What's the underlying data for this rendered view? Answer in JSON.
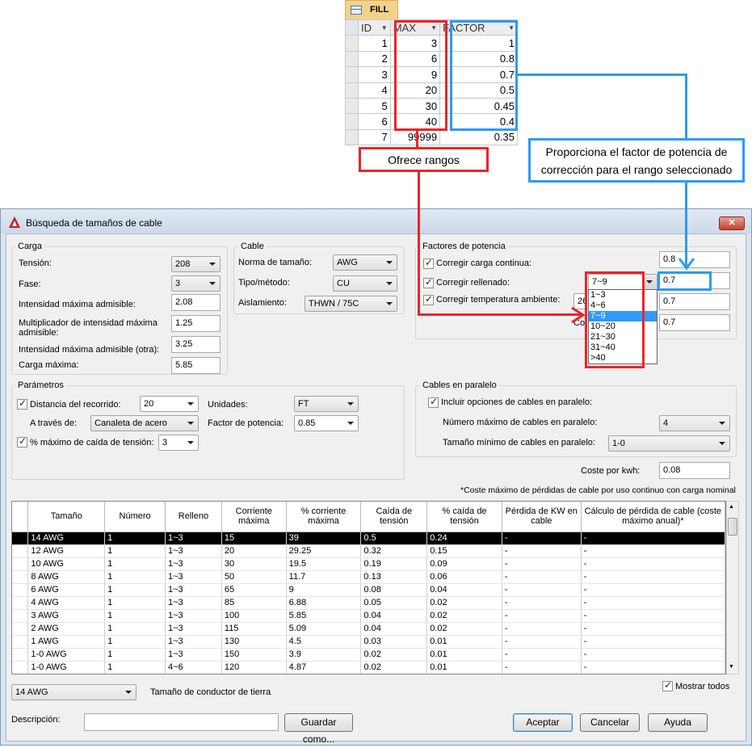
{
  "fill_table": {
    "tab_label": "FILL",
    "columns": [
      "ID",
      "MAX",
      "FACTOR"
    ],
    "rows": [
      [
        "1",
        "3",
        "1"
      ],
      [
        "2",
        "6",
        "0.8"
      ],
      [
        "3",
        "9",
        "0.7"
      ],
      [
        "4",
        "20",
        "0.5"
      ],
      [
        "5",
        "30",
        "0.45"
      ],
      [
        "6",
        "40",
        "0.4"
      ],
      [
        "7",
        "99999",
        "0.35"
      ]
    ]
  },
  "callouts": {
    "ranges": "Ofrece rangos",
    "factor": "Proporciona el factor de potencia de corrección para el rango seleccionado"
  },
  "dialog": {
    "title": "Búsqueda de tamaños de cable",
    "carga": {
      "group_label": "Carga",
      "tension_label": "Tensión:",
      "tension_value": "208",
      "fase_label": "Fase:",
      "fase_value": "3",
      "intensidad_label": "Intensidad máxima admisible:",
      "intensidad_value": "2.08",
      "multiplicador_label": "Multiplicador de intensidad máxima admisible:",
      "multiplicador_value": "1.25",
      "intensidad_otra_label": "Intensidad máxima admisible (otra):",
      "intensidad_otra_value": "3.25",
      "carga_max_label": "Carga máxima:",
      "carga_max_value": "5.85"
    },
    "cable": {
      "group_label": "Cable",
      "norma_label": "Norma de tamaño:",
      "norma_value": "AWG",
      "tipo_label": "Tipo/método:",
      "tipo_value": "CU",
      "aislamiento_label": "Aislamiento:",
      "aislamiento_value": "THWN / 75C"
    },
    "factores": {
      "group_label": "Factores de potencia",
      "continua_label": "Corregir carga continua:",
      "continua_value": "0.8",
      "rellenado_label": "Corregir rellenado:",
      "rellenado_combo": "7~9",
      "rellenado_value": "0.7",
      "temperatura_label": "Corregir temperatura ambiente:",
      "temperatura_combo": "26",
      "fourth_label_partial": "Co",
      "fourth_value": "0.7",
      "dropdown_options": [
        "1~3",
        "4~6",
        "7~9",
        "10~20",
        "21~30",
        "31~40",
        ">40"
      ],
      "dropdown_selected": "7~9"
    },
    "parametros": {
      "group_label": "Parámetros",
      "distancia_label": "Distancia del recorrido:",
      "distancia_value": "20",
      "unidades_label": "Unidades:",
      "unidades_value": "FT",
      "atraves_label": "A través de:",
      "atraves_value": "Canaleta de acero",
      "factor_label": "Factor de potencia:",
      "factor_value": "0.85",
      "caida_label": "% máximo de caída de tensión:",
      "caida_value": "3"
    },
    "paralelo": {
      "group_label": "Cables en paralelo",
      "incluir_label": "Incluir opciones de cables en paralelo:",
      "numero_label": "Número máximo de cables en paralelo:",
      "numero_value": "4",
      "tamano_label": "Tamaño mínimo de cables en paralelo:",
      "tamano_value": "1-0"
    },
    "coste_label": "Coste por kwh:",
    "coste_value": "0.08",
    "note": "*Coste máximo de pérdidas de cable por uso continuo con carga nominal",
    "grid": {
      "headers": [
        "Tamaño",
        "Número",
        "Relleno",
        "Corriente máxima",
        "% corriente máxima",
        "Caída de tensión",
        "% caída de tensión",
        "Pérdida de KW en cable",
        "Cálculo de pérdida de cable (coste máximo anual)*"
      ],
      "rows": [
        [
          "14 AWG",
          "1",
          "1~3",
          "15",
          "39",
          "0.5",
          "0.24",
          "-",
          "-"
        ],
        [
          "12 AWG",
          "1",
          "1~3",
          "20",
          "29.25",
          "0.32",
          "0.15",
          "-",
          "-"
        ],
        [
          "10 AWG",
          "1",
          "1~3",
          "30",
          "19.5",
          "0.19",
          "0.09",
          "-",
          "-"
        ],
        [
          "8 AWG",
          "1",
          "1~3",
          "50",
          "11.7",
          "0.13",
          "0.06",
          "-",
          "-"
        ],
        [
          "6 AWG",
          "1",
          "1~3",
          "65",
          "9",
          "0.08",
          "0.04",
          "-",
          "-"
        ],
        [
          "4 AWG",
          "1",
          "1~3",
          "85",
          "6.88",
          "0.05",
          "0.02",
          "-",
          "-"
        ],
        [
          "3 AWG",
          "1",
          "1~3",
          "100",
          "5.85",
          "0.04",
          "0.02",
          "-",
          "-"
        ],
        [
          "2 AWG",
          "1",
          "1~3",
          "115",
          "5.09",
          "0.04",
          "0.02",
          "-",
          "-"
        ],
        [
          "1 AWG",
          "1",
          "1~3",
          "130",
          "4.5",
          "0.03",
          "0.01",
          "-",
          "-"
        ],
        [
          "1-0 AWG",
          "1",
          "1~3",
          "150",
          "3.9",
          "0.02",
          "0.01",
          "-",
          "-"
        ],
        [
          "1-0 AWG",
          "1",
          "4~6",
          "120",
          "4.87",
          "0.02",
          "0.01",
          "-",
          "-"
        ]
      ]
    },
    "ground_value": "14 AWG",
    "ground_label": "Tamaño de conductor de tierra",
    "mostrar_label": "Mostrar todos",
    "descripcion_label": "Descripción:",
    "guardar_label": "Guardar como...",
    "aceptar_label": "Aceptar",
    "cancelar_label": "Cancelar",
    "ayuda_label": "Ayuda"
  }
}
